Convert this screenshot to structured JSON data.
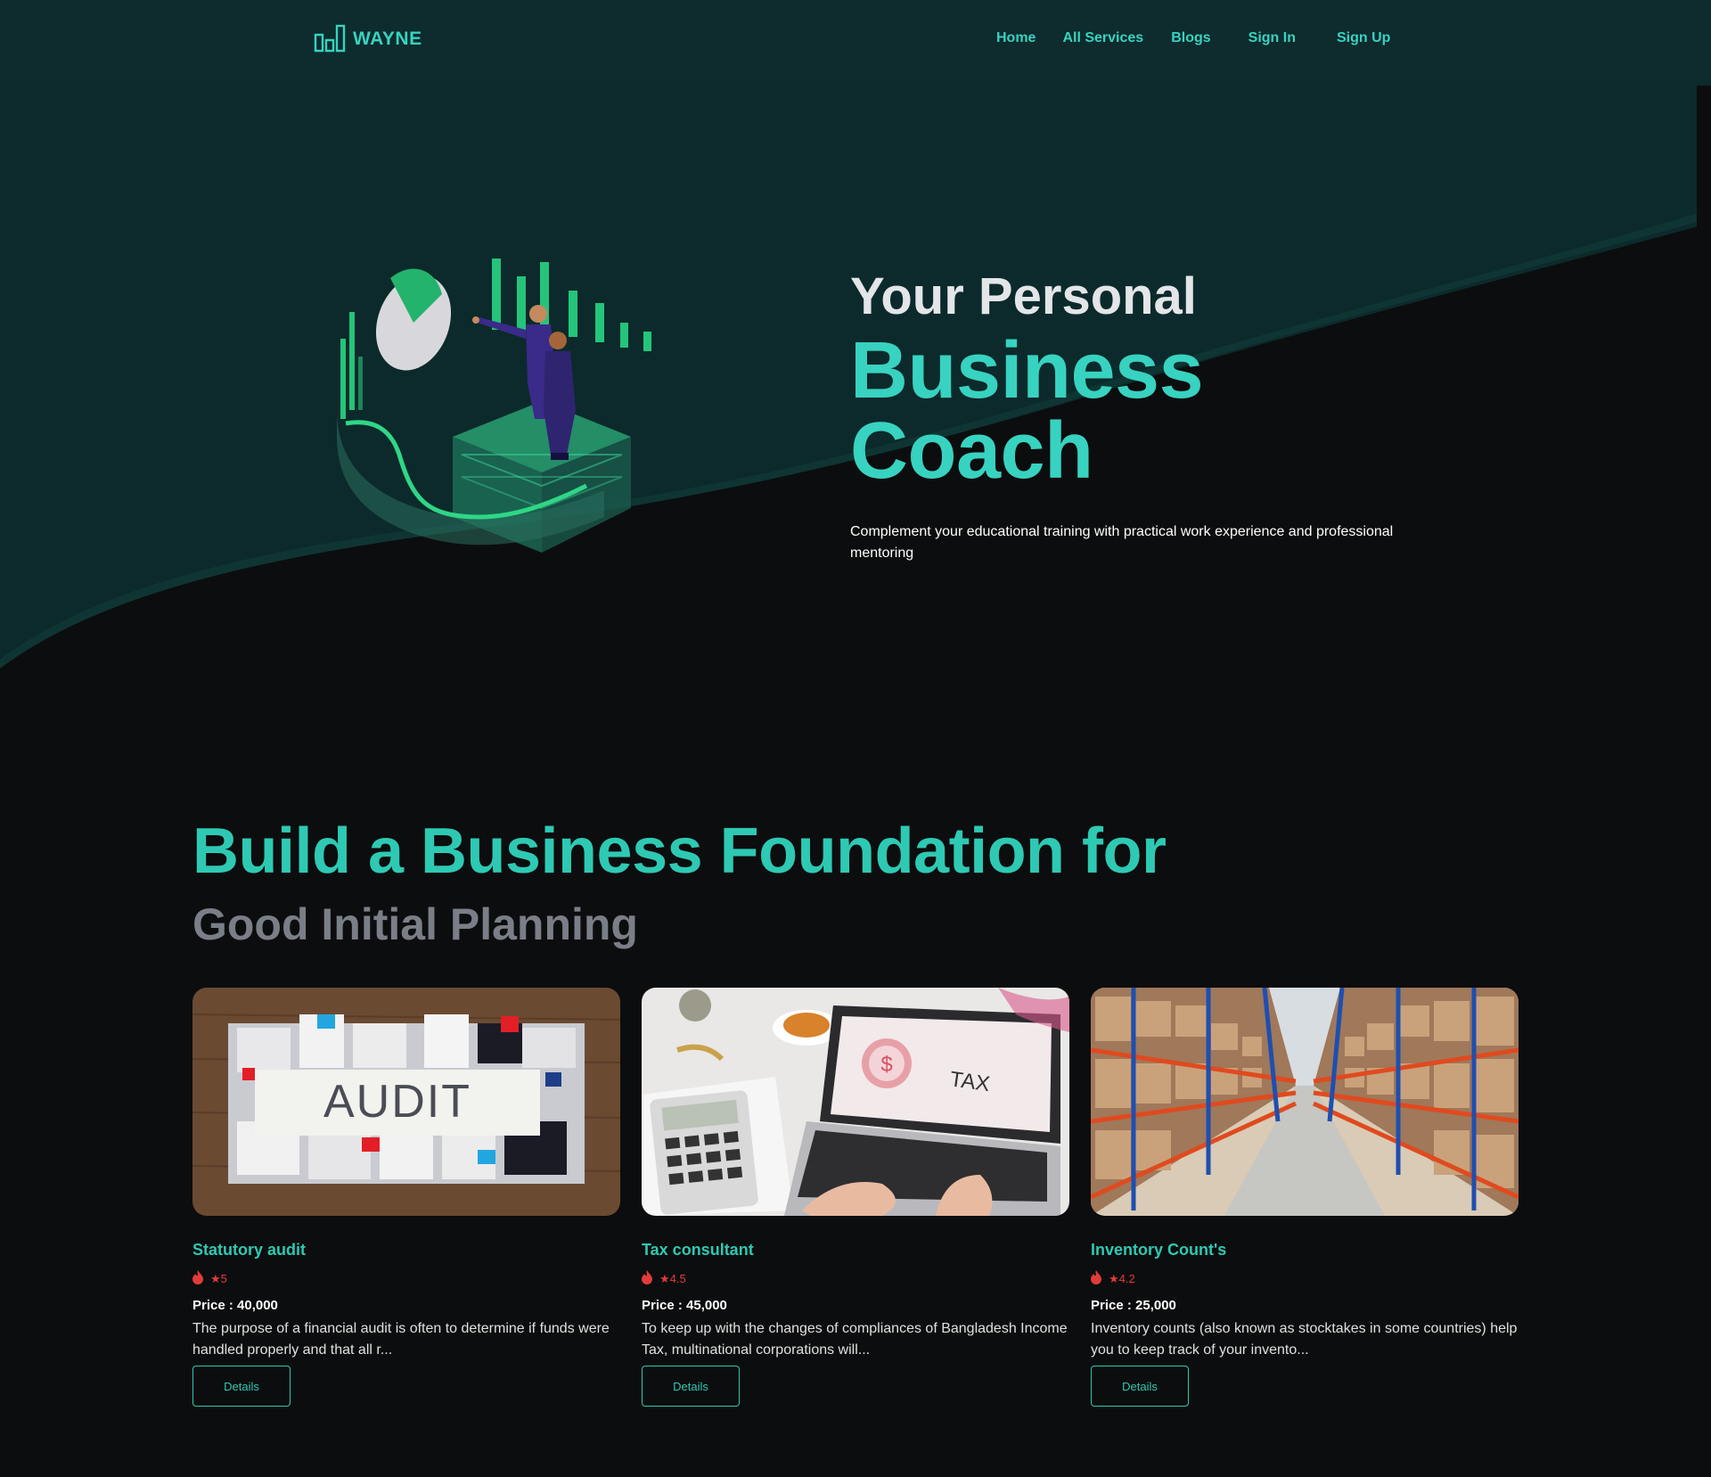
{
  "navbar": {
    "logo_text": "WAYNE",
    "links": [
      "Home",
      "All Services",
      "Blogs",
      "Sign In",
      "Sign Up"
    ]
  },
  "hero": {
    "line1": "Your Personal",
    "line2": "Business",
    "line3": "Coach",
    "description": "Complement your educational training with practical work experience and professional mentoring"
  },
  "section": {
    "title": "Build a Business Foundation for",
    "subtitle": "Good Initial Planning"
  },
  "services": [
    {
      "title": "Statutory audit",
      "rating": "★5",
      "price": "Price : 40,000",
      "description": "The purpose of a financial audit is often to determine if funds were handled properly and that all r...",
      "button": "Details",
      "image_text": "AUDIT"
    },
    {
      "title": "Tax consultant",
      "rating": "★4.5",
      "price": "Price : 45,000",
      "description": "To keep up with the changes of compliances of Bangladesh Income Tax, multinational corporations will...",
      "button": "Details",
      "image_text": "TAX"
    },
    {
      "title": "Inventory Count's",
      "rating": "★4.2",
      "price": "Price : 25,000",
      "description": "Inventory counts (also known as stocktakes in some countries) help you to keep track of your invento...",
      "button": "Details",
      "image_text": ""
    }
  ],
  "colors": {
    "accent": "#38d2c0",
    "nav_bg": "#0e2b2d",
    "page_bg": "#0c0d0e",
    "rating": "#e23b3b"
  },
  "icons": {
    "logo": "bar-chart-icon",
    "rating": "fire-icon"
  }
}
